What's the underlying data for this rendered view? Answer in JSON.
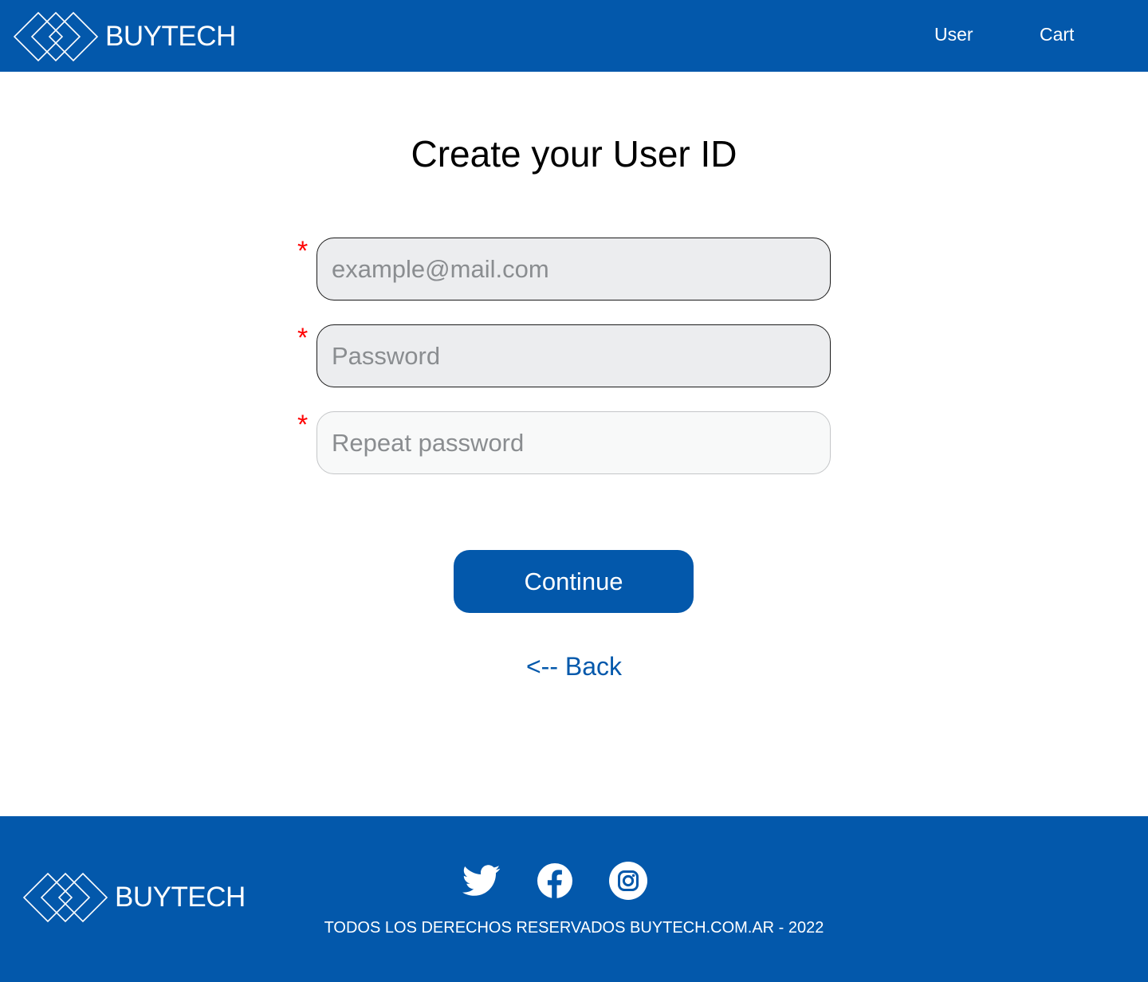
{
  "header": {
    "brand": "BUYTECH",
    "nav": {
      "user": "User",
      "cart": "Cart"
    }
  },
  "main": {
    "title": "Create your User ID",
    "required_mark": "*",
    "fields": {
      "email_placeholder": "example@mail.com",
      "password_placeholder": "Password",
      "repeat_password_placeholder": "Repeat password"
    },
    "continue_label": "Continue",
    "back_label": "<-- Back"
  },
  "footer": {
    "brand": "BUYTECH",
    "socials": [
      "twitter-icon",
      "facebook-icon",
      "instagram-icon"
    ],
    "copyright": "TODOS LOS DERECHOS RESERVADOS BUYTECH.COM.AR - 2022"
  },
  "colors": {
    "brand_blue": "#0358ab",
    "required_red": "#ff0000",
    "filled_input_bg": "#ecedef",
    "empty_input_bg": "#f8f9f9"
  }
}
